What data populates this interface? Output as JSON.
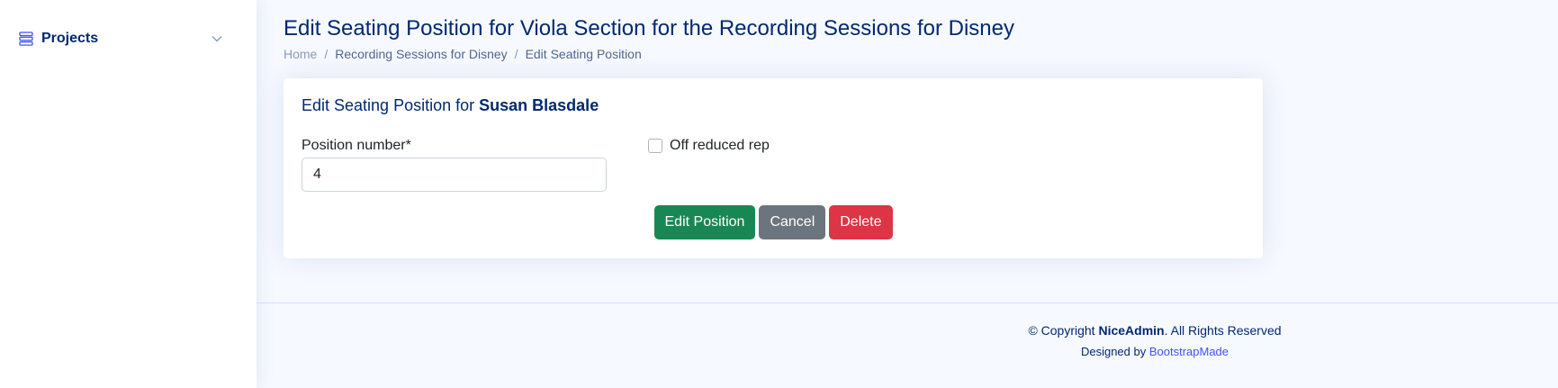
{
  "sidebar": {
    "nav": {
      "label": "Projects",
      "icon": "menu-list-icon",
      "chevron": "chevron-down-icon"
    }
  },
  "header": {
    "title": "Edit Seating Position for Viola Section for the Recording Sessions for Disney",
    "breadcrumb": {
      "home": "Home",
      "project": "Recording Sessions for Disney",
      "current": "Edit Seating Position",
      "separator": "/"
    }
  },
  "card": {
    "title_prefix": "Edit Seating Position for",
    "person": "Susan Blasdale",
    "position_label": "Position number*",
    "position_value": "4",
    "checkbox_label": "Off reduced rep",
    "checkbox_checked": false,
    "buttons": {
      "edit": "Edit Position",
      "cancel": "Cancel",
      "delete": "Delete"
    }
  },
  "footer": {
    "copyright_symbol": "© Copyright",
    "brand": "NiceAdmin",
    "rights": ". All Rights Reserved",
    "designed_by": "Designed by",
    "designer": "BootstrapMade"
  },
  "colors": {
    "primary_text": "#012970",
    "edit_button": "#198754",
    "cancel_button": "#6c757d",
    "delete_button": "#dc3545",
    "link": "#4154f1"
  }
}
